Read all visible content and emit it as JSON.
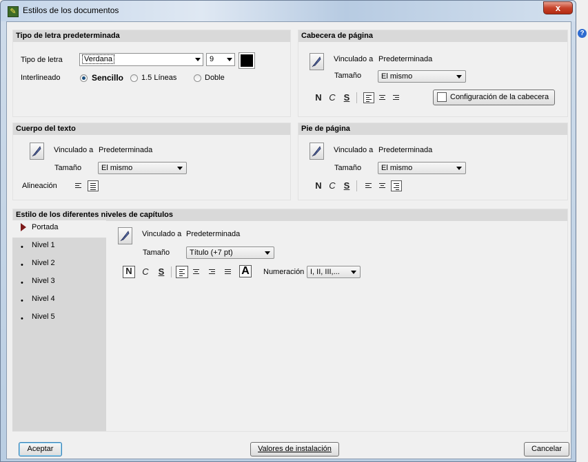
{
  "window": {
    "title": "Estilos de los documentos",
    "close_label": "x",
    "help_label": "?"
  },
  "tipo_letra": {
    "header": "Tipo de letra predeterminada",
    "font_label": "Tipo de letra",
    "font_value": "Verdana",
    "size_value": "9",
    "color": "#000000",
    "spacing_label": "Interlineado",
    "options": [
      {
        "label": "Sencillo",
        "checked": true
      },
      {
        "label": "1.5 Líneas",
        "checked": false
      },
      {
        "label": "Doble",
        "checked": false
      }
    ]
  },
  "cabecera": {
    "header": "Cabecera de página",
    "linked_label": "Vinculado a",
    "linked_value": "Predeterminada",
    "size_label": "Tamaño",
    "size_value": "El mismo",
    "bold": "N",
    "italic": "C",
    "underline": "S",
    "config_button": "Configuración de la cabecera"
  },
  "cuerpo": {
    "header": "Cuerpo del texto",
    "linked_label": "Vinculado a",
    "linked_value": "Predeterminada",
    "size_label": "Tamaño",
    "size_value": "El mismo",
    "align_label": "Alineación"
  },
  "pie": {
    "header": "Pie de página",
    "linked_label": "Vinculado a",
    "linked_value": "Predeterminada",
    "size_label": "Tamaño",
    "size_value": "El mismo",
    "bold": "N",
    "italic": "C",
    "underline": "S"
  },
  "niveles": {
    "header": "Estilo de los diferentes niveles de capítulos",
    "items": [
      "Portada",
      "Nivel 1",
      "Nivel 2",
      "Nivel 3",
      "Nivel 4",
      "Nivel 5"
    ],
    "selected": "Portada",
    "linked_label": "Vinculado a",
    "linked_value": "Predeterminada",
    "size_label": "Tamaño",
    "size_value": "Título (+7 pt)",
    "bold": "N",
    "italic": "C",
    "underline": "S",
    "big_a": "A",
    "numbering_label": "Numeración",
    "numbering_value": "I, II, III,..."
  },
  "footer": {
    "accept": "Aceptar",
    "defaults": "Valores de instalación",
    "cancel": "Cancelar"
  }
}
